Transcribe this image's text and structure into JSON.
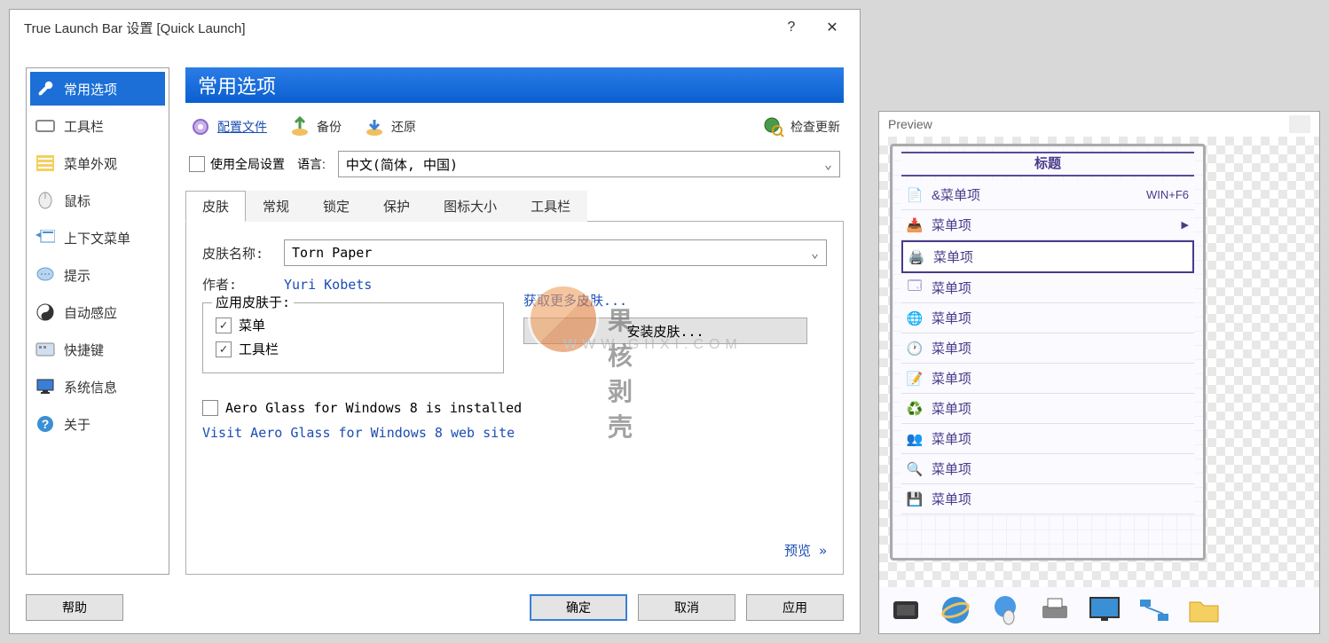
{
  "dialog": {
    "title": "True Launch Bar 设置 [Quick Launch]",
    "help_icon": "?",
    "close_icon": "✕"
  },
  "sidebar": {
    "items": [
      {
        "label": "常用选项",
        "icon": "wrench"
      },
      {
        "label": "工具栏",
        "icon": "rect"
      },
      {
        "label": "菜单外观",
        "icon": "list"
      },
      {
        "label": "鼠标",
        "icon": "mouse"
      },
      {
        "label": "上下文菜单",
        "icon": "context"
      },
      {
        "label": "提示",
        "icon": "bubble"
      },
      {
        "label": "自动感应",
        "icon": "yinyang"
      },
      {
        "label": "快捷键",
        "icon": "keyboard"
      },
      {
        "label": "系统信息",
        "icon": "monitor"
      },
      {
        "label": "关于",
        "icon": "help"
      }
    ],
    "selected_index": 0
  },
  "panel": {
    "heading": "常用选项"
  },
  "toolbar": {
    "config": "配置文件",
    "backup": "备份",
    "restore": "还原",
    "check_update": "检查更新"
  },
  "global": {
    "use_global": "使用全局设置",
    "use_global_checked": false,
    "language_label": "语言:",
    "language_value": "中文(简体, 中国)"
  },
  "tabs": {
    "items": [
      "皮肤",
      "常规",
      "锁定",
      "保护",
      "图标大小",
      "工具栏"
    ],
    "active_index": 0
  },
  "skin": {
    "name_label": "皮肤名称:",
    "name_value": "Torn Paper",
    "author_label": "作者:",
    "author_value": "Yuri Kobets",
    "apply_to": "应用皮肤于:",
    "menu_label": "菜单",
    "menu_checked": true,
    "toolbar_label": "工具栏",
    "toolbar_checked": true,
    "more_skins": "获取更多皮肤...",
    "install_skin": "安装皮肤...",
    "aero_label": "Aero Glass for Windows 8 is installed",
    "aero_checked": false,
    "aero_link": "Visit Aero Glass for Windows 8 web site",
    "preview_link": "预览 »"
  },
  "buttons": {
    "help": "帮助",
    "ok": "确定",
    "cancel": "取消",
    "apply": "应用"
  },
  "preview": {
    "title": "Preview",
    "menu_title": "标题",
    "items": [
      {
        "label": "&菜单项",
        "shortcut": "WIN+F6",
        "icon": "page"
      },
      {
        "label": "菜单项",
        "arrow": true,
        "icon": "tray"
      },
      {
        "label": "菜单项",
        "selected": true,
        "icon": "printer"
      },
      {
        "label": "菜单项",
        "icon": "window"
      },
      {
        "label": "菜单项",
        "icon": "globe"
      },
      {
        "label": "菜单项",
        "icon": "clock"
      },
      {
        "label": "菜单项",
        "icon": "note"
      },
      {
        "label": "菜单项",
        "icon": "recycle"
      },
      {
        "label": "菜单项",
        "icon": "people"
      },
      {
        "label": "菜单项",
        "icon": "search"
      },
      {
        "label": "菜单项",
        "icon": "drive"
      }
    ],
    "taskbar_icons": [
      "chip",
      "ie",
      "globe-mouse",
      "printer",
      "monitor",
      "network",
      "folder"
    ]
  },
  "watermark": {
    "text1": "果核剥壳",
    "text2": "WWW.GHXI.COM"
  }
}
